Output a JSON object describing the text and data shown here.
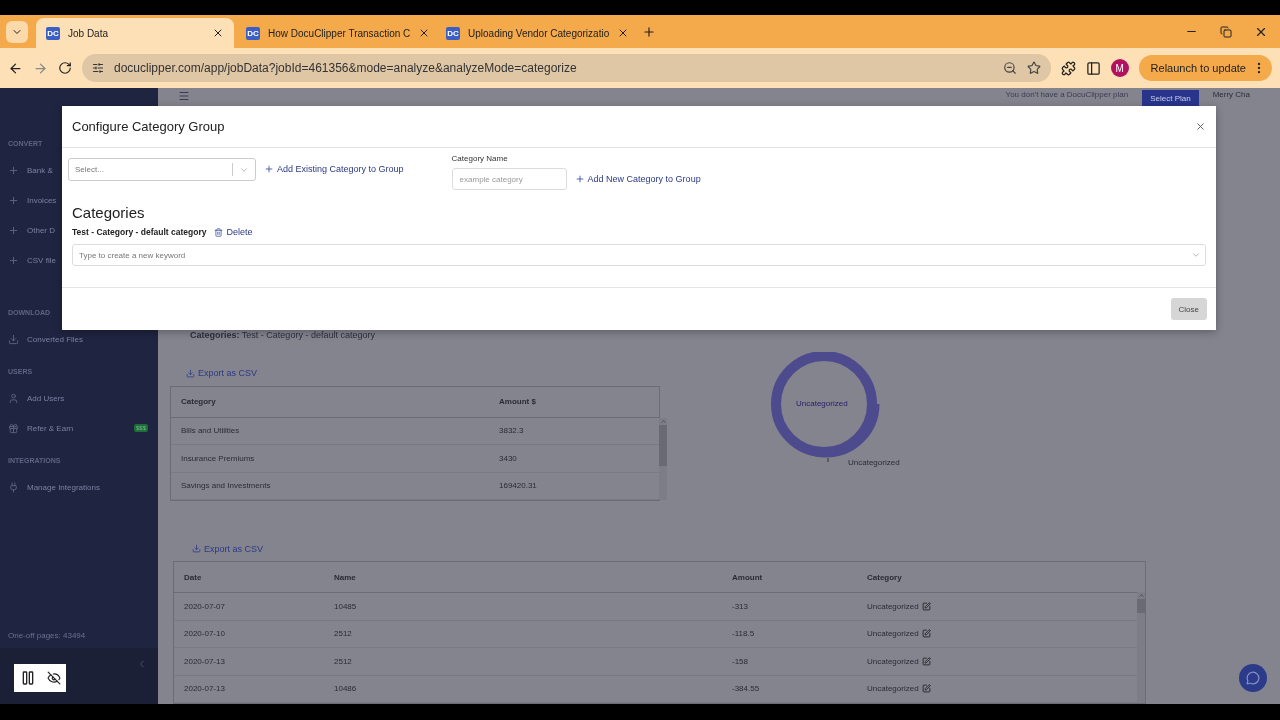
{
  "browser": {
    "tabs": [
      {
        "title": "Job Data",
        "favicon": "DC",
        "selected": true
      },
      {
        "title": "How DocuClipper Transaction C",
        "favicon": "DC",
        "selected": false
      },
      {
        "title": "Uploading Vendor Categorizatio",
        "favicon": "DC",
        "selected": false
      }
    ],
    "url": "docuclipper.com/app/jobData?jobId=461356&mode=analyze&analyzeMode=categorize",
    "profile_initial": "M",
    "relaunch_label": "Relaunch to update"
  },
  "header": {
    "notice": "You don't have a DocuClipper plan",
    "plan_button": "Select Plan",
    "user": "Merry Cha"
  },
  "sidebar": {
    "sections": [
      {
        "title": "CONVERT",
        "items": [
          {
            "label": "Bank &"
          },
          {
            "label": "Invoices"
          },
          {
            "label": "Other D"
          },
          {
            "label": "CSV file"
          }
        ]
      },
      {
        "title": "DOWNLOAD",
        "items": [
          {
            "label": "Converted Files"
          }
        ]
      },
      {
        "title": "USERS",
        "items": [
          {
            "label": "Add Users"
          },
          {
            "label": "Refer & Earn",
            "badge": "$$$"
          }
        ]
      },
      {
        "title": "INTEGRATIONS",
        "items": [
          {
            "label": "Manage Integrations"
          }
        ]
      }
    ],
    "footer": "One-off pages: 43494"
  },
  "modal": {
    "title": "Configure Category Group",
    "select_placeholder": "Select...",
    "add_existing_label": "Add Existing Category to Group",
    "name_label": "Category Name",
    "name_placeholder": "example category",
    "add_new_label": "Add New Category to Group",
    "categories_heading": "Categories",
    "categories": [
      {
        "name": "Test - Category - default category",
        "delete_label": "Delete",
        "keyword_placeholder": "Type to create a new keyword"
      }
    ],
    "close_label": "Close"
  },
  "summary": {
    "label": "Categories:",
    "value": "Test - Category - default category"
  },
  "category_table": {
    "export_label": "Export as CSV",
    "columns": [
      "Category",
      "Amount $"
    ],
    "rows": [
      [
        "Bills and Utilities",
        "3832.3"
      ],
      [
        "Insurance Premiums",
        "3430"
      ],
      [
        "Savings and Investments",
        "169420.31"
      ]
    ]
  },
  "donut": {
    "center_label": "Uncategorized",
    "legend_label": "Uncategorized"
  },
  "transactions": {
    "export_label": "Export as CSV",
    "columns": [
      "Date",
      "Name",
      "Amount",
      "Category"
    ],
    "rows": [
      [
        "2020-07-07",
        "10485",
        "-313",
        "Uncategorized"
      ],
      [
        "2020-07-10",
        "2512",
        "-118.5",
        "Uncategorized"
      ],
      [
        "2020-07-13",
        "2512",
        "-158",
        "Uncategorized"
      ],
      [
        "2020-07-13",
        "10486",
        "-384.55",
        "Uncategorized"
      ]
    ]
  }
}
